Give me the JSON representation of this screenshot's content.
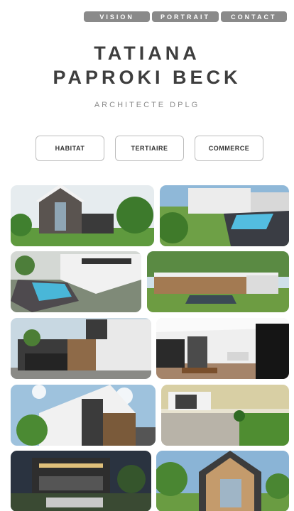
{
  "nav": {
    "items": [
      {
        "label": "VISION"
      },
      {
        "label": "PORTRAIT"
      },
      {
        "label": "CONTACT"
      }
    ]
  },
  "brand": {
    "line1": "TATIANA",
    "line2": "PAPROKI BECK",
    "subtitle": "ARCHITECTE DPLG"
  },
  "categories": [
    {
      "label": "HABITAT"
    },
    {
      "label": "TERTIAIRE"
    },
    {
      "label": "COMMERCE"
    }
  ],
  "colors": {
    "nav_bg": "#8a8a8a",
    "title": "#3e3e3e",
    "subtitle": "#8c8c8c",
    "button_border": "#bdbdbd"
  }
}
